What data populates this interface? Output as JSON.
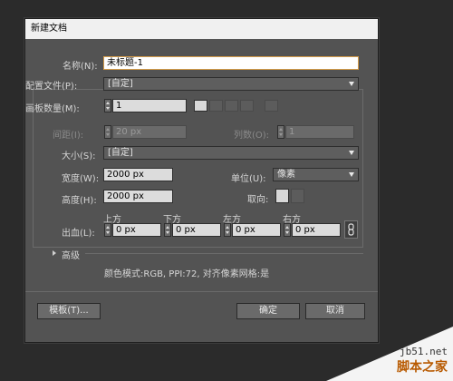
{
  "dialog": {
    "title": "新建文档",
    "name": {
      "label": "名称(N):",
      "value": "未标题-1"
    },
    "profile": {
      "label": "配置文件(P):",
      "value": "[自定]"
    },
    "artboard_count": {
      "label": "画板数量(M):",
      "value": "1"
    },
    "spacing": {
      "label": "间距(I):",
      "value": "20 px"
    },
    "columns": {
      "label": "列数(O):",
      "value": "1"
    },
    "size": {
      "label": "大小(S):",
      "value": "[自定]"
    },
    "width": {
      "label": "宽度(W):",
      "value": "2000 px"
    },
    "units": {
      "label": "单位(U):",
      "value": "像素"
    },
    "height": {
      "label": "高度(H):",
      "value": "2000 px"
    },
    "orientation": {
      "label": "取向:"
    },
    "bleed": {
      "label": "出血(L):",
      "top": {
        "label": "上方",
        "value": "0 px"
      },
      "bottom": {
        "label": "下方",
        "value": "0 px"
      },
      "left": {
        "label": "左方",
        "value": "0 px"
      },
      "right": {
        "label": "右方",
        "value": "0 px"
      }
    },
    "advanced": {
      "label": "高级"
    },
    "info": "颜色模式:RGB, PPI:72, 对齐像素网格:是",
    "buttons": {
      "templates": "模板(T)...",
      "ok": "确定",
      "cancel": "取消"
    }
  },
  "watermark": {
    "domain": "jb51.net",
    "site": "脚本之家"
  },
  "colors": {
    "dialog_bg": "#535353",
    "accent_border": "#d39b4a",
    "page_bg": "#2b2b2b"
  }
}
